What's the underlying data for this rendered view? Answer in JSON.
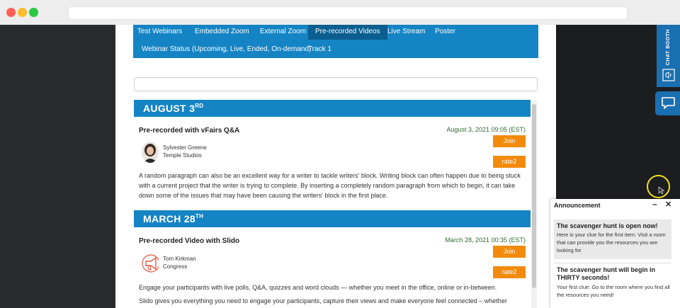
{
  "tabs": [
    {
      "label": "Test Webinars"
    },
    {
      "label": "Embedded Zoom"
    },
    {
      "label": "External Zoom"
    },
    {
      "label": "Pre-recorded Videos"
    },
    {
      "label": "Live Stream"
    },
    {
      "label": "Poster"
    },
    {
      "label": "Webinar Status (Upcoming, Live, Ended, On-demand)"
    },
    {
      "label": "Track 1"
    }
  ],
  "active_tab": "Pre-recorded Videos",
  "sections": [
    {
      "date_main": "AUGUST 3",
      "date_suffix": "RD",
      "event": {
        "title": "Pre-recorded with vFairs Q&A",
        "datetime": "August 3, 2021 09:05 (EST)",
        "speaker_name": "Sylvester Greene",
        "speaker_org": "Temple Studios",
        "join_label": "Join",
        "rate_label": "rate2",
        "description": "A random paragraph can also be an excellent way for a writer to tackle writers' block. Writing block can often happen due to being stuck with a current project that the writer is trying to complete. By inserting a completely random paragraph from which to begin, it can take down some of the issues that may have been causing the writers' block in the first place."
      }
    },
    {
      "date_main": "MARCH 28",
      "date_suffix": "TH",
      "event": {
        "title": "Pre-recorded Video with Slido",
        "datetime": "March 28, 2021 00:35 (EST)",
        "speaker_name": "Tom Kirkman",
        "speaker_org": "Congress",
        "join_label": "Join",
        "rate_label": "rate2",
        "description_1": "Engage your participants with live polls, Q&A, quizzes and word clouds — whether you meet in the office, online or in-between.",
        "description_2": "Slido gives you everything you need to engage your participants, capture their views and make everyone feel connected – whether"
      }
    }
  ],
  "chat_booth_label": "CHAT BOOTH",
  "announcement": {
    "heading": "Announcement",
    "minimize": "–",
    "close": "✕",
    "items": [
      {
        "title": "The scavenger hunt is open now!",
        "body": "Here is your clue for the first item: Visit a room that can provide you the resources you are looking for"
      },
      {
        "title": "The scavenger hunt will begin in THIRTY seconds!",
        "body": "Your first clue: Go to the room where you find all the resources you need!"
      }
    ]
  },
  "colors": {
    "brand_blue": "#1584c4",
    "active_tab": "#0b5e8f",
    "button_orange": "#f28b0c",
    "date_green": "#2e6b2e"
  }
}
